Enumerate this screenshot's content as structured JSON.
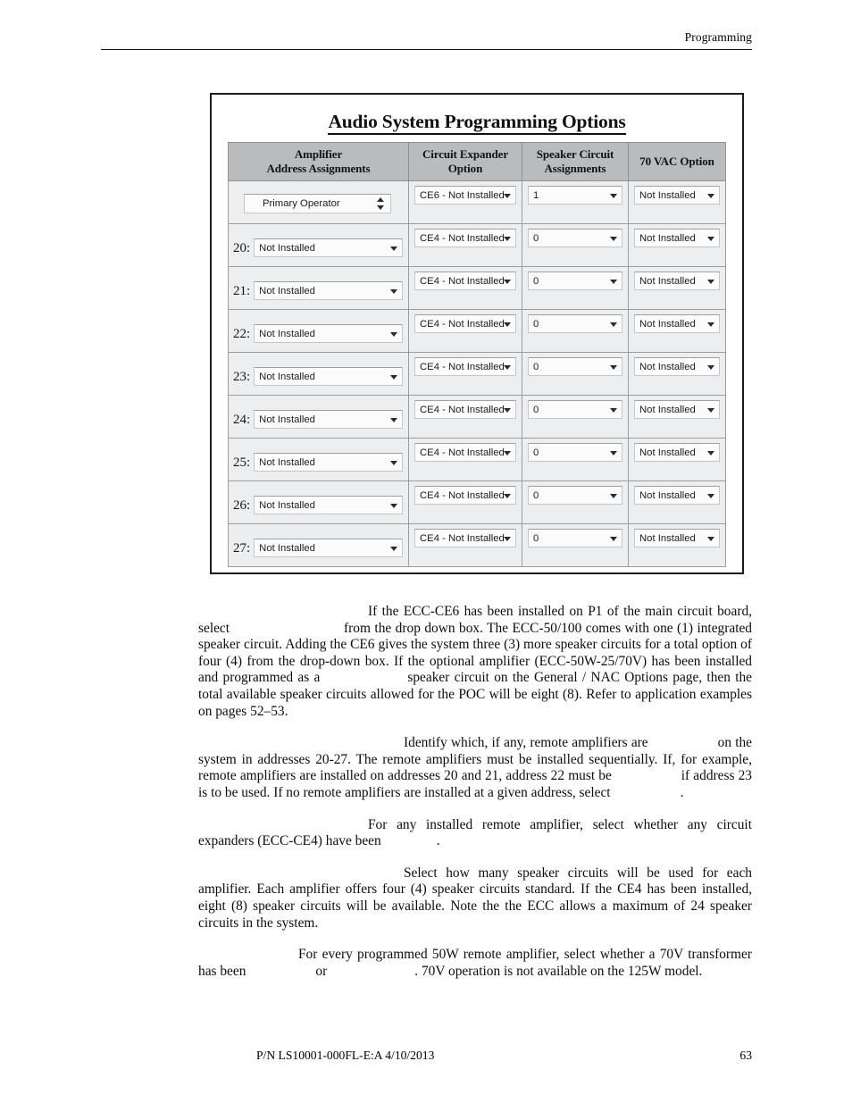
{
  "header": {
    "section_label": "Programming"
  },
  "figure": {
    "title": "Audio System Programming Options",
    "columns": [
      "Amplifier\nAddress Assignments",
      "Circuit Expander\nOption",
      "Speaker Circuit\nAssignments",
      "70 VAC Option"
    ],
    "column_lines": {
      "c1_l1": "Amplifier",
      "c1_l2": "Address Assignments",
      "c2_l1": "Circuit Expander",
      "c2_l2": "Option",
      "c3_l1": "Speaker Circuit",
      "c3_l2": "Assignments",
      "c4_l1": "70 VAC Option"
    },
    "rows": [
      {
        "address_label": "",
        "address_value": "Primary Operator",
        "address_control": "spinner",
        "circuit_expander": "CE6 - Not Installed",
        "speaker_circuits": "1",
        "vac_option": "Not Installed"
      },
      {
        "address_label": "20:",
        "address_value": "Not Installed",
        "address_control": "dropdown",
        "circuit_expander": "CE4 - Not Installed",
        "speaker_circuits": "0",
        "vac_option": "Not Installed"
      },
      {
        "address_label": "21:",
        "address_value": "Not Installed",
        "address_control": "dropdown",
        "circuit_expander": "CE4 - Not Installed",
        "speaker_circuits": "0",
        "vac_option": "Not Installed"
      },
      {
        "address_label": "22:",
        "address_value": "Not Installed",
        "address_control": "dropdown",
        "circuit_expander": "CE4 - Not Installed",
        "speaker_circuits": "0",
        "vac_option": "Not Installed"
      },
      {
        "address_label": "23:",
        "address_value": "Not Installed",
        "address_control": "dropdown",
        "circuit_expander": "CE4 - Not Installed",
        "speaker_circuits": "0",
        "vac_option": "Not Installed"
      },
      {
        "address_label": "24:",
        "address_value": "Not Installed",
        "address_control": "dropdown",
        "circuit_expander": "CE4 - Not Installed",
        "speaker_circuits": "0",
        "vac_option": "Not Installed"
      },
      {
        "address_label": "25:",
        "address_value": "Not Installed",
        "address_control": "dropdown",
        "circuit_expander": "CE4 - Not Installed",
        "speaker_circuits": "0",
        "vac_option": "Not Installed"
      },
      {
        "address_label": "26:",
        "address_value": "Not Installed",
        "address_control": "dropdown",
        "circuit_expander": "CE4 - Not Installed",
        "speaker_circuits": "0",
        "vac_option": "Not Installed"
      },
      {
        "address_label": "27:",
        "address_value": "Not Installed",
        "address_control": "dropdown",
        "circuit_expander": "CE4 - Not Installed",
        "speaker_circuits": "0",
        "vac_option": "Not Installed"
      }
    ]
  },
  "body": {
    "p1_a": "If the ECC-CE6 has been installed on P1 of the main circuit board, select",
    "p1_b": "from the drop down box.  The ECC-50/100 comes with one (1) integrated speaker circuit.  Adding the CE6 gives the system three (3) more speaker circuits for a total option of four (4) from the drop-down box.  If the optional amplifier (ECC-50W-25/70V) has been installed and programmed as a",
    "p1_c": "speaker circuit on the General / NAC Options page, then the total available speaker circuits allowed for the POC will be eight (8).  Refer to application examples on pages 52–53.",
    "p2_a": "Identify which, if any, remote amplifiers are",
    "p2_b": "on the system in addresses 20-27.  The remote amplifiers must be installed sequentially.  If, for example, remote amplifiers are installed on addresses 20 and 21, address 22 must be",
    "p2_c": "if address 23 is to be used.  If no remote amplifiers are installed at a given address, select",
    "p2_d": ".",
    "p3_a": "For any installed remote amplifier, select whether any circuit expanders (ECC-CE4) have been",
    "p3_b": ".",
    "p4_a": "Select how many speaker circuits will be used for each amplifier.  Each amplifier offers four (4) speaker circuits standard.  If the CE4 has been installed, eight (8) speaker circuits will be available.  Note the the ECC allows a maximum of 24 speaker circuits in the system.",
    "p5_a": "For every programmed 50W remote amplifier, select whether a 70V transformer has been",
    "p5_b": "or",
    "p5_c": ".  70V operation is not available on the 125W model."
  },
  "footer": {
    "part_number": "P/N LS10001-000FL-E:A  4/10/2013",
    "page_number": "63"
  }
}
